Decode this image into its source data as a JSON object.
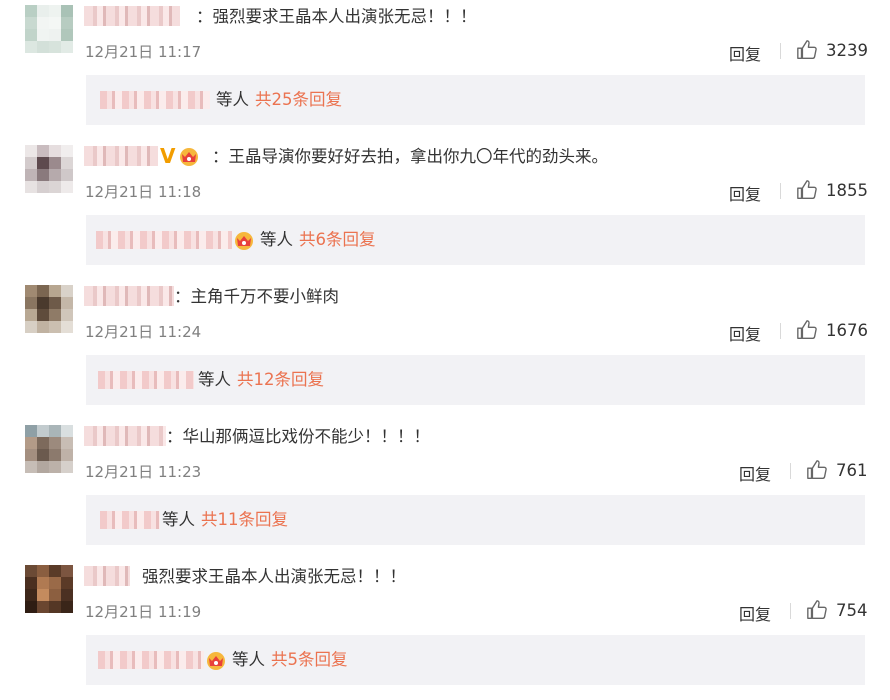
{
  "colors": {
    "link": "#eb7350",
    "time": "#808080",
    "sub_bg": "#f2f2f5",
    "vip": "#f29d00"
  },
  "comments": [
    {
      "text": "：强烈要求王晶本人出演张无忌！！！",
      "time": "12月21日 11:17",
      "reply": "回复",
      "likes": "3239",
      "sub_etc": "等人",
      "sub_count": "共25条回复"
    },
    {
      "text": "：王晶导演你要好好去拍，拿出你九〇年代的劲头来。",
      "time": "12月21日 11:18",
      "reply": "回复",
      "likes": "1855",
      "sub_etc": "等人",
      "sub_count": "共6条回复",
      "badges": [
        "vip-v-icon",
        "crown-icon"
      ]
    },
    {
      "text": "：主角千万不要小鲜肉",
      "time": "12月21日 11:24",
      "reply": "回复",
      "likes": "1676",
      "sub_etc": "等人",
      "sub_count": "共12条回复"
    },
    {
      "text": "：华山那俩逗比戏份不能少！！！！",
      "time": "12月21日 11:23",
      "reply": "回复",
      "likes": "761",
      "sub_etc": "等人",
      "sub_count": "共11条回复"
    },
    {
      "text": "强烈要求王晶本人出演张无忌！！！",
      "time": "12月21日 11:19",
      "reply": "回复",
      "likes": "754",
      "sub_etc": "等人",
      "sub_count": "共5条回复"
    }
  ]
}
